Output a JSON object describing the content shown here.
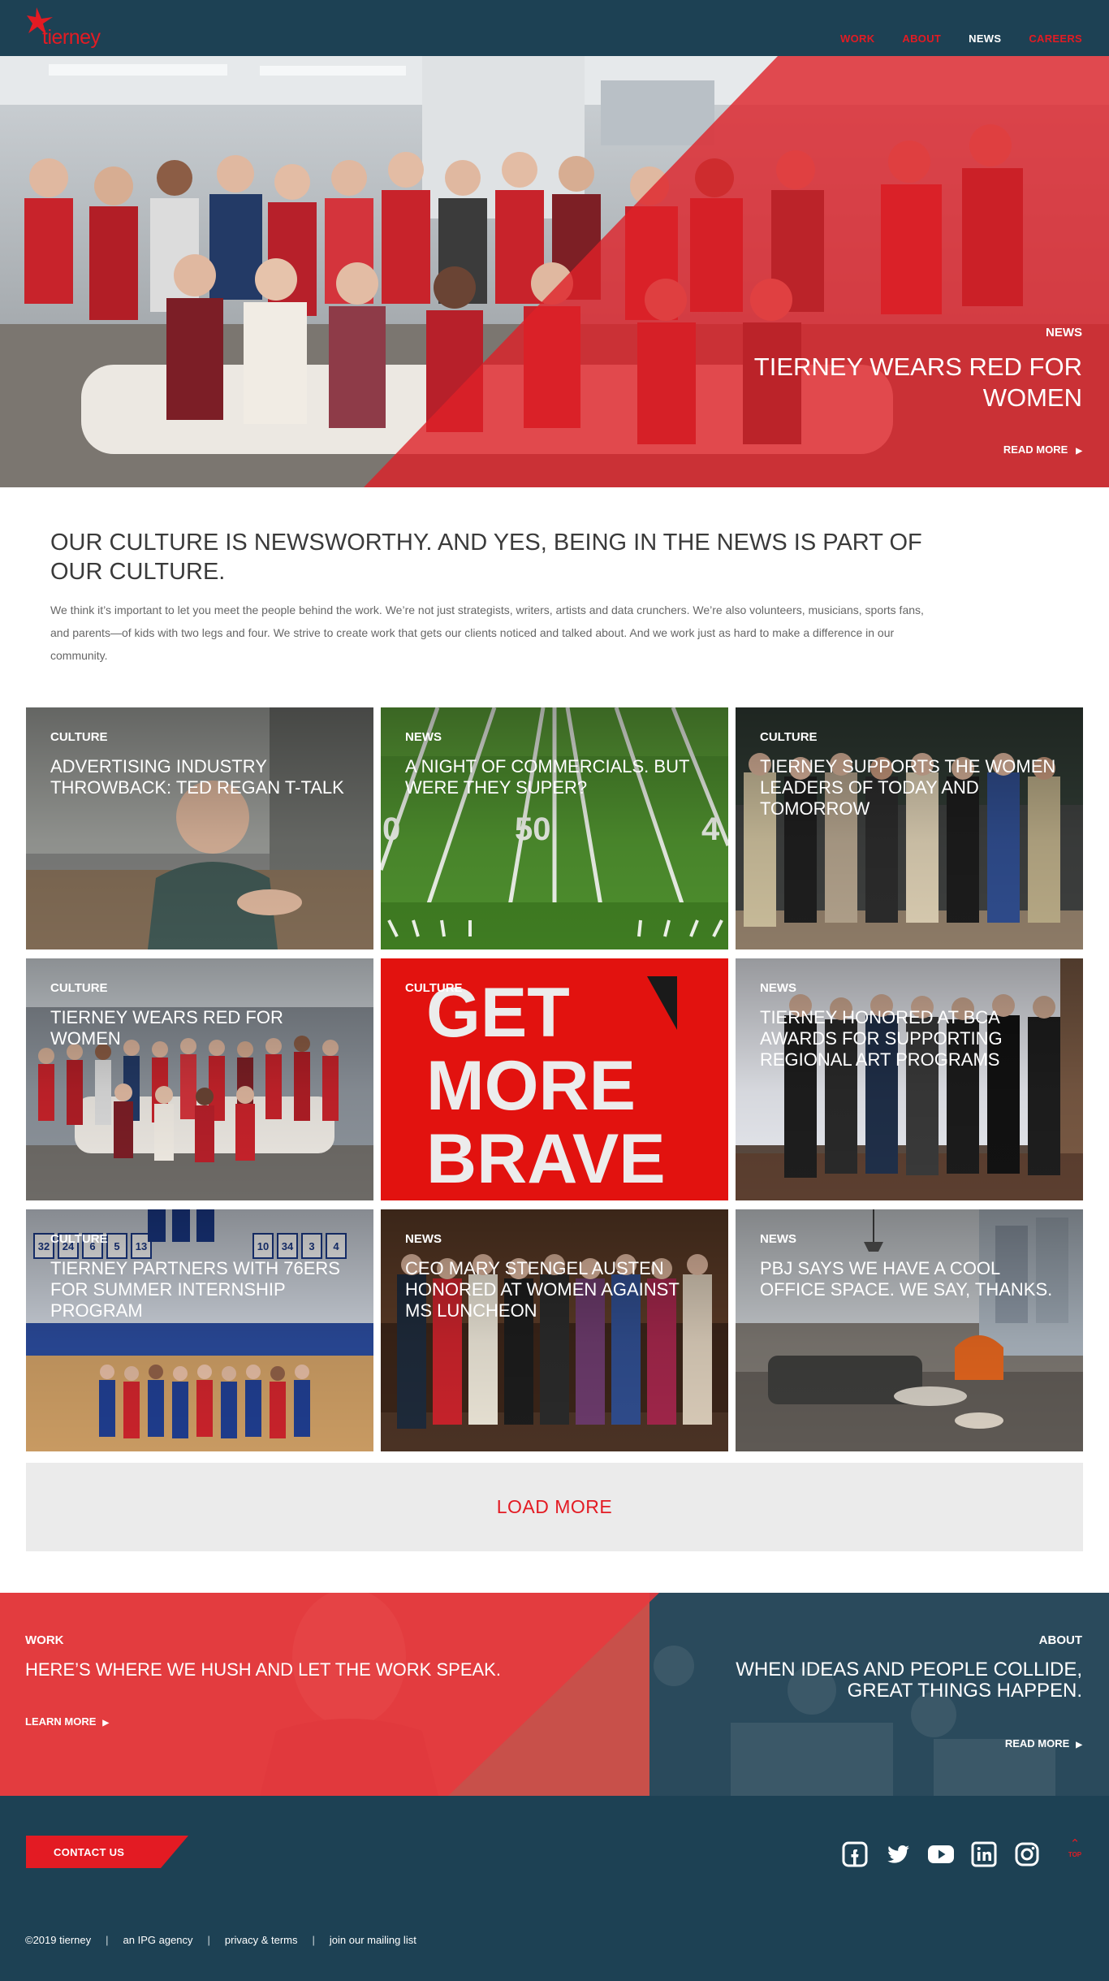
{
  "brand": {
    "logo_text": "tierney",
    "red": "#e31b23",
    "navy": "#1d4154"
  },
  "nav": {
    "items": [
      "WORK",
      "ABOUT",
      "NEWS",
      "CAREERS"
    ],
    "active": "NEWS"
  },
  "hero": {
    "category": "NEWS",
    "title": "TIERNEY WEARS RED FOR WOMEN",
    "cta": "READ MORE"
  },
  "intro": {
    "title": "OUR CULTURE IS NEWSWORTHY. AND YES, BEING IN THE NEWS IS PART OF OUR CULTURE.",
    "text": "We think it’s important to let you meet the people behind the work. We’re not just strategists, writers, artists and data crunchers.  We’re also volunteers, musicians, sports fans, and parents—of kids with two legs and four. We strive to create work that gets our clients noticed and talked about.  And we work just as hard to make a difference in our community."
  },
  "cards": [
    {
      "category": "CULTURE",
      "title": "ADVERTISING INDUSTRY THROWBACK: TED REGAN T-TALK"
    },
    {
      "category": "NEWS",
      "title": "A NIGHT OF COMMERCIALS. BUT WERE THEY SUPER?"
    },
    {
      "category": "CULTURE",
      "title": "TIERNEY SUPPORTS THE WOMEN LEADERS OF TODAY AND TOMORROW"
    },
    {
      "category": "CULTURE",
      "title": "TIERNEY WEARS RED FOR WOMEN"
    },
    {
      "category": "CULTURE",
      "title": ""
    },
    {
      "category": "NEWS",
      "title": "TIERNEY HONORED AT BCA AWARDS FOR SUPPORTING REGIONAL ART PROGRAMS"
    },
    {
      "category": "CULTURE",
      "title": "TIERNEY PARTNERS WITH 76ERS FOR SUMMER INTERNSHIP PROGRAM"
    },
    {
      "category": "NEWS",
      "title": "CEO MARY STENGEL AUSTEN HONORED AT WOMEN AGAINST MS LUNCHEON"
    },
    {
      "category": "NEWS",
      "title": "PBJ SAYS WE HAVE A COOL OFFICE SPACE. WE SAY, THANKS."
    }
  ],
  "brave_poster": {
    "lines": [
      "GET",
      "MORE",
      "BRAVE"
    ]
  },
  "field_numbers": {
    "left": "0",
    "mid": "50",
    "right": "4"
  },
  "banners": [
    "32",
    "24",
    "6",
    "5",
    "13",
    "10",
    "34",
    "3",
    "4"
  ],
  "load_more": "LOAD MORE",
  "promo": {
    "work": {
      "category": "WORK",
      "title": "HERE’S WHERE WE HUSH AND LET THE WORK SPEAK.",
      "cta": "LEARN MORE"
    },
    "about": {
      "category": "ABOUT",
      "title": "WHEN IDEAS AND PEOPLE COLLIDE, GREAT THINGS  HAPPEN.",
      "cta": "READ MORE"
    }
  },
  "footer": {
    "contact": "CONTACT US",
    "social_icons": [
      "facebook-icon",
      "twitter-icon",
      "youtube-icon",
      "linkedin-icon",
      "instagram-icon"
    ],
    "top_label": "TOP",
    "links": [
      "©2019 tierney",
      "an IPG agency",
      "privacy & terms",
      "join our mailing list"
    ]
  }
}
